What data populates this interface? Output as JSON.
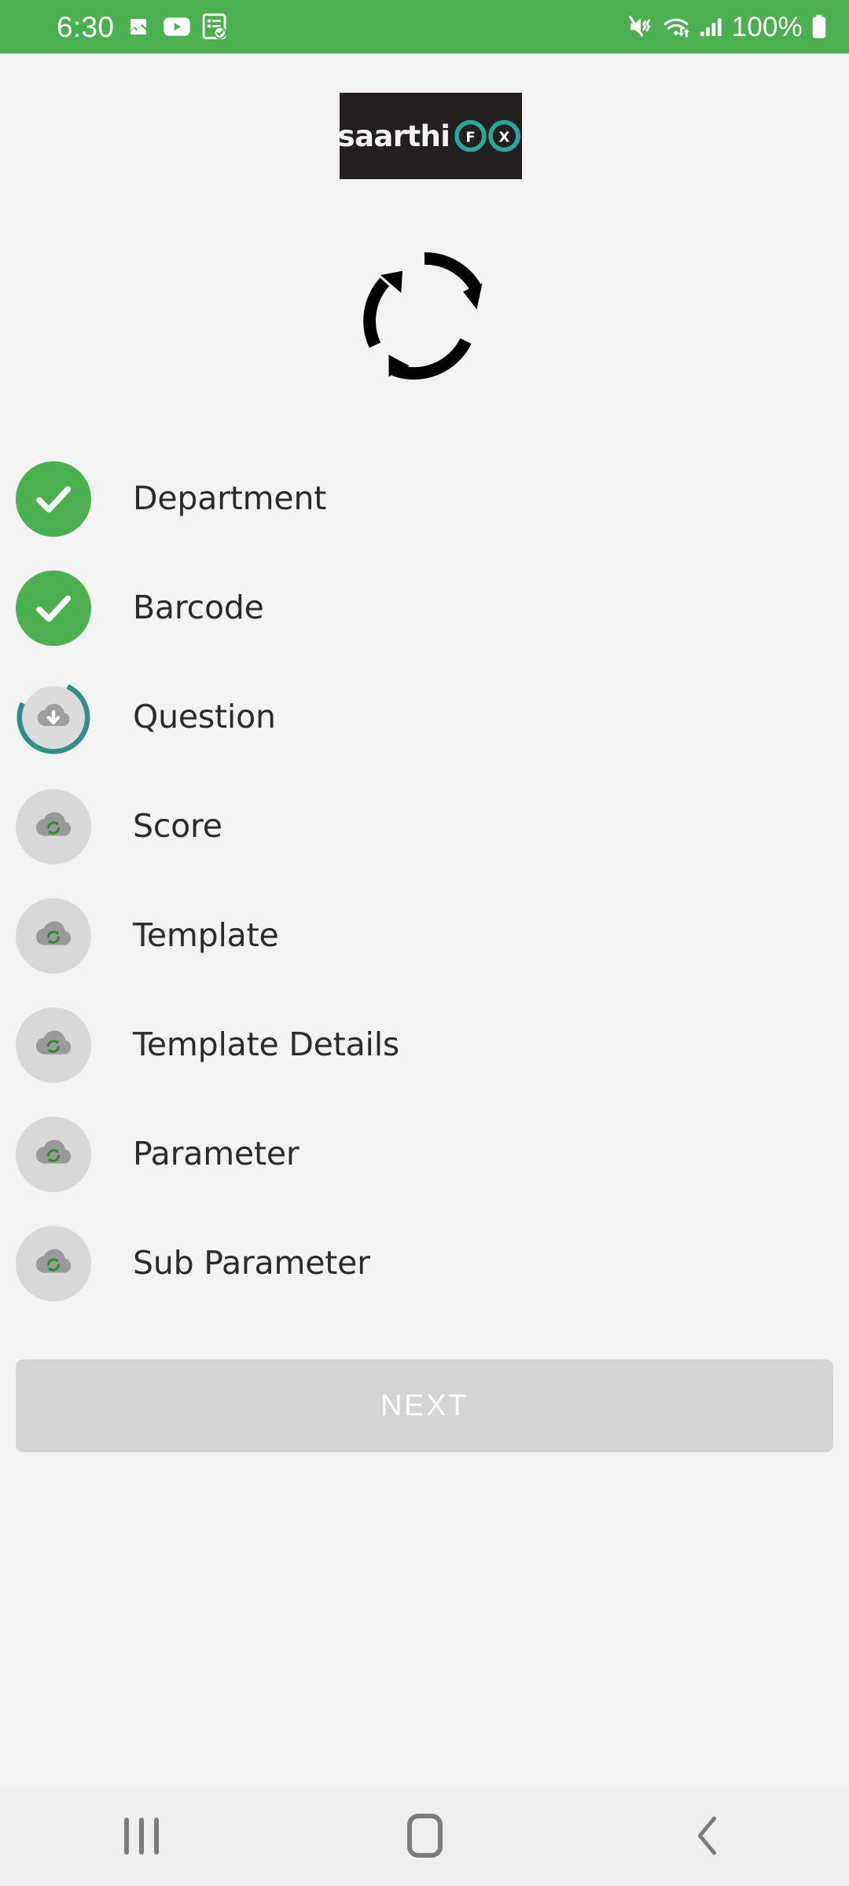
{
  "status_bar": {
    "time": "6:30",
    "battery_percent": "100%",
    "background_color": "#4caf50",
    "left_icons": [
      "gallery-icon",
      "youtube-icon",
      "form-checked-icon"
    ],
    "right_icons": [
      "mute-vibrate-icon",
      "wifi-transfer-icon",
      "signal-bars-icon",
      "battery-full-icon"
    ]
  },
  "logo": {
    "text": "saarthi",
    "mark_left_letter": "F",
    "mark_right_letter": "X",
    "mark_color": "#2aa79b",
    "background_color": "#231f20"
  },
  "hero": {
    "icon": "sync-circular-arrows-icon",
    "color": "#000000"
  },
  "sync_list": {
    "items": [
      {
        "label": "Department",
        "state": "done",
        "icon": "check-icon"
      },
      {
        "label": "Barcode",
        "state": "done",
        "icon": "check-icon"
      },
      {
        "label": "Question",
        "state": "progress",
        "icon": "cloud-download-icon",
        "progress_percent": 75
      },
      {
        "label": "Score",
        "state": "pending",
        "icon": "cloud-sync-icon"
      },
      {
        "label": "Template",
        "state": "pending",
        "icon": "cloud-sync-icon"
      },
      {
        "label": "Template Details",
        "state": "pending",
        "icon": "cloud-sync-icon"
      },
      {
        "label": "Parameter",
        "state": "pending",
        "icon": "cloud-sync-icon"
      },
      {
        "label": "Sub Parameter",
        "state": "pending",
        "icon": "cloud-sync-icon"
      }
    ],
    "done_color": "#4caf50",
    "progress_color": "#2f8f84",
    "pending_color": "#d8d8d8"
  },
  "primary_action": {
    "label": "NEXT",
    "enabled": false,
    "background_color": "#d4d4d4",
    "text_color": "#ffffff"
  },
  "navigation_bar": {
    "recents_label": "Recents",
    "home_label": "Home",
    "back_label": "Back",
    "icon_color": "#7c7c7c"
  },
  "page": {
    "background_color": "#f2f3f2"
  }
}
